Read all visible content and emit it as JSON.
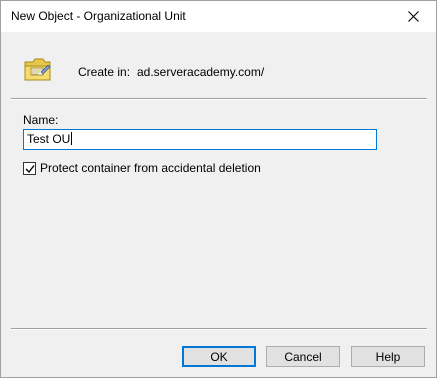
{
  "window": {
    "title": "New Object - Organizational Unit",
    "close_icon": "close-icon"
  },
  "header": {
    "icon": "folder-ou-icon",
    "create_in_label": "Create in:",
    "create_in_value": "ad.serveracademy.com/"
  },
  "form": {
    "name_label": "Name:",
    "name_value": "Test OU",
    "protect_label": "Protect container from accidental deletion",
    "protect_checked": true
  },
  "buttons": {
    "ok": "OK",
    "cancel": "Cancel",
    "help": "Help"
  }
}
